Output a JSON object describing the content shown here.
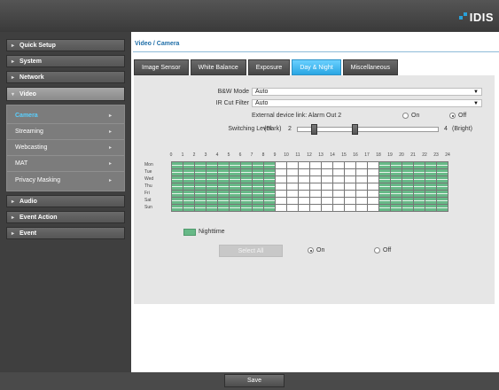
{
  "brand": {
    "logo_text": "IDIS",
    "accent": "#2aa0d8"
  },
  "sidebar": {
    "items": [
      {
        "label": "Quick Setup"
      },
      {
        "label": "System"
      },
      {
        "label": "Network"
      },
      {
        "label": "Video",
        "expanded": true
      },
      {
        "label": "Audio"
      },
      {
        "label": "Event Action"
      },
      {
        "label": "Event"
      }
    ],
    "video_sub": [
      {
        "label": "Camera",
        "selected": true
      },
      {
        "label": "Streaming"
      },
      {
        "label": "Webcasting"
      },
      {
        "label": "MAT"
      },
      {
        "label": "Privacy Masking"
      }
    ]
  },
  "page": {
    "title": "Video / Camera"
  },
  "tabs": [
    {
      "label": "Image Sensor"
    },
    {
      "label": "White Balance"
    },
    {
      "label": "Exposure"
    },
    {
      "label": "Day & Night",
      "active": true
    },
    {
      "label": "Miscellaneous"
    }
  ],
  "form": {
    "bw_mode_label": "B&W Mode",
    "bw_mode_value": "Auto",
    "ir_cut_label": "IR Cut Filter",
    "ir_cut_value": "Auto",
    "ext_link_label": "External device link: Alarm Out 2",
    "ext_on": "On",
    "ext_off": "Off",
    "ext_selected": "Off",
    "switching_label": "Switching Level",
    "dark_label": "(Dark)",
    "range_min": "2",
    "range_max": "4",
    "bright_label": "(Bright)",
    "range_low_value": 2,
    "range_high_value": 3
  },
  "schedule": {
    "hours": [
      "0",
      "1",
      "2",
      "3",
      "4",
      "5",
      "6",
      "7",
      "8",
      "9",
      "10",
      "11",
      "12",
      "13",
      "14",
      "15",
      "16",
      "17",
      "18",
      "19",
      "20",
      "21",
      "22",
      "23",
      "24"
    ],
    "days": [
      "Mon",
      "Tue",
      "Wed",
      "Thu",
      "Fri",
      "Sat",
      "Sun"
    ],
    "night_hours": [
      0,
      1,
      2,
      3,
      4,
      5,
      6,
      7,
      8,
      18,
      19,
      20,
      21,
      22,
      23
    ],
    "legend": "Nighttime",
    "night_color": "#67b987",
    "select_all": "Select All",
    "opt_on": "On",
    "opt_off": "Off",
    "selected_opt": "On"
  },
  "footer": {
    "save_label": "Save"
  }
}
